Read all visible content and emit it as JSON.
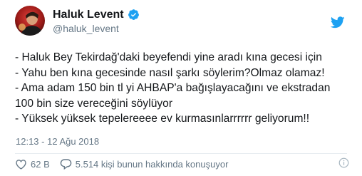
{
  "user": {
    "display_name": "Haluk Levent",
    "handle": "@haluk_levent",
    "verified": true
  },
  "tweet": {
    "text": "- Haluk Bey Tekirdağ'daki beyefendi yine aradı kına gecesi için\n- Yahu ben kına gecesinde nasıl şarkı söylerim?Olmaz olamaz!\n- Ama adam 150 bin tl yi AHBAP'a bağışlayacağını ve ekstradan\n100 bin size vereceğini söylüyor\n- Yüksek yüksek tepelereeee ev kurmasınlarrrrrr geliyorum!!",
    "timestamp": "12:13 - 12 Ağu 2018"
  },
  "actions": {
    "likes": "62 B",
    "conversation": "5.514 kişi bunun hakkında konuşuyor"
  },
  "icons": {
    "verified": "verified-badge-icon",
    "bird": "twitter-bird-icon",
    "like": "heart-icon",
    "reply": "speech-bubble-icon",
    "info": "info-icon"
  },
  "colors": {
    "twitter_blue": "#1da1f2",
    "secondary_text": "#657786",
    "primary_text": "#14171a"
  }
}
